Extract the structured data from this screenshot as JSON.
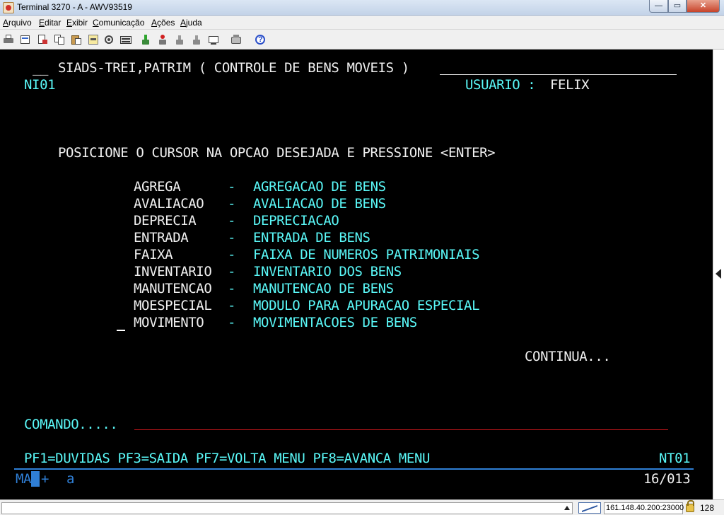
{
  "window": {
    "title": "Terminal 3270 - A - AWV93519",
    "minimize_glyph": "—",
    "maximize_glyph": "▭",
    "close_glyph": "✕"
  },
  "menu": [
    "Arquivo",
    "Editar",
    "Exibir",
    "Comunicação",
    "Ações",
    "Ajuda"
  ],
  "toolbar_icons": [
    "print-icon",
    "copy-screen-icon",
    "send-file-icon",
    "copy-icon",
    "paste-icon",
    "macro-icon",
    "settings-icon",
    "keyboard-icon",
    "connect-icon",
    "disconnect-icon",
    "reset-icon",
    "transfer-icon",
    "color-icon",
    "record-icon",
    "help-icon"
  ],
  "screen": {
    "header_prefix": "__",
    "header_title": "SIADS-TREI,PATRIM ( CONTROLE DE BENS MOVEIS )",
    "screen_id": "NI01",
    "user_label": "USUARIO :",
    "user_name": "FELIX",
    "instruction": "POSICIONE O CURSOR NA OPCAO DESEJADA E PRESSIONE <ENTER>",
    "options": [
      {
        "code": "AGREGA",
        "sep": "-",
        "desc": "AGREGACAO DE BENS"
      },
      {
        "code": "AVALIACAO",
        "sep": "-",
        "desc": "AVALIACAO DE BENS"
      },
      {
        "code": "DEPRECIA",
        "sep": "-",
        "desc": "DEPRECIACAO"
      },
      {
        "code": "ENTRADA",
        "sep": "-",
        "desc": "ENTRADA DE BENS"
      },
      {
        "code": "FAIXA",
        "sep": "-",
        "desc": "FAIXA DE NUMEROS PATRIMONIAIS"
      },
      {
        "code": "INVENTARIO",
        "sep": "-",
        "desc": "INVENTARIO DOS BENS"
      },
      {
        "code": "MANUTENCAO",
        "sep": "-",
        "desc": "MANUTENCAO DE BENS"
      },
      {
        "code": "MOESPECIAL",
        "sep": "-",
        "desc": "MODULO PARA APURACAO ESPECIAL"
      },
      {
        "code": "MOVIMENTO",
        "sep": "-",
        "desc": "MOVIMENTACOES DE BENS"
      }
    ],
    "continua": "CONTINUA...",
    "command_label": "COMANDO.....",
    "command_value": "",
    "pf_keys": "PF1=DUVIDAS PF3=SAIDA PF7=VOLTA MENU PF8=AVANCA MENU",
    "screen_code": "NT01"
  },
  "oia": {
    "mode": "MA",
    "plus": "+",
    "field": "a",
    "cursor_position": "16/013"
  },
  "status": {
    "host": "161.148.40.200:23000",
    "sessions": "128"
  },
  "colors": {
    "terminal_bg": "#000000",
    "field_cyan": "#5af8f8",
    "field_white": "#f0f0f0",
    "input_underline": "#c8171d",
    "oia_blue": "#2f7fd6"
  }
}
